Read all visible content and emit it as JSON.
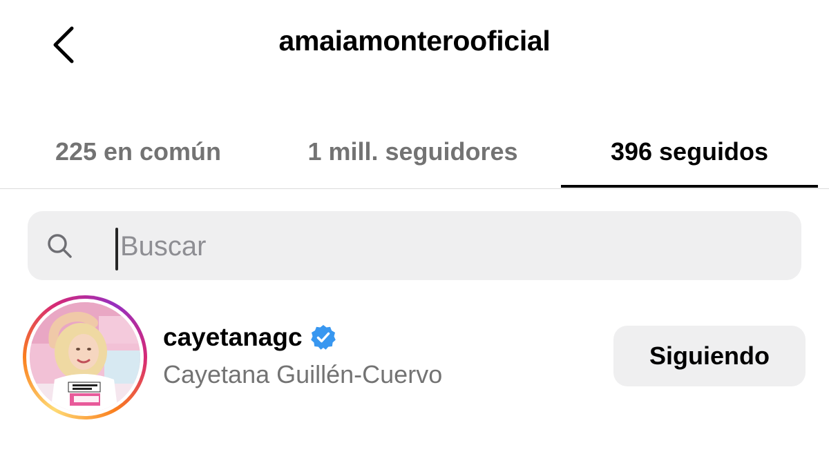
{
  "header": {
    "title": "amaiamonterooficial",
    "back_icon": "chevron-left-icon"
  },
  "tabs": [
    {
      "label": "225 en común",
      "active": false
    },
    {
      "label": "1 mill. seguidores",
      "active": false
    },
    {
      "label": "396 seguidos",
      "active": true
    }
  ],
  "search": {
    "placeholder": "Buscar",
    "value": "",
    "icon": "search-icon"
  },
  "users": [
    {
      "username": "cayetanagc",
      "verified": true,
      "full_name": "Cayetana Guillén-Cuervo",
      "button_label": "Siguiendo",
      "has_story_ring": true
    }
  ],
  "colors": {
    "background": "#ffffff",
    "text_primary": "#000000",
    "text_secondary": "#737373",
    "search_bg": "#efeff0",
    "button_bg": "#efeff0",
    "verified_blue": "#3897f0",
    "divider": "#dbdbdb"
  }
}
